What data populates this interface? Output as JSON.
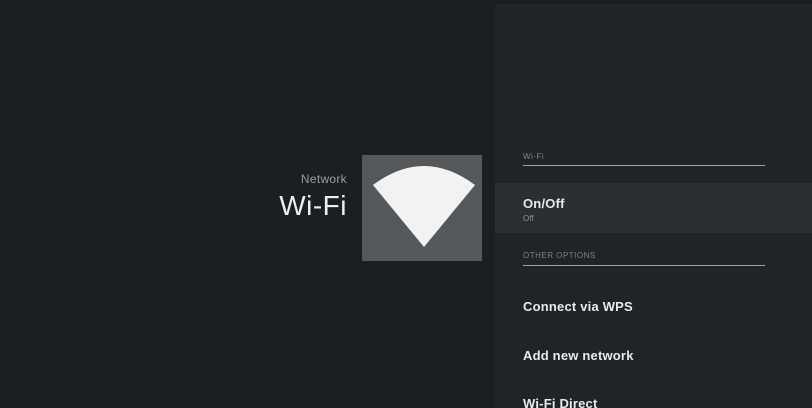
{
  "header": {
    "breadcrumb": "Network",
    "title": "Wi-Fi"
  },
  "icon": {
    "name": "wifi-icon",
    "tile_color": "#55585b",
    "glyph_color": "#f2f2f2"
  },
  "panel": {
    "section_wifi": "Wi-Fi",
    "on_off": {
      "label": "On/Off",
      "value": "Off"
    },
    "section_other": "OTHER OPTIONS",
    "options": [
      {
        "label": "Connect via WPS"
      },
      {
        "label": "Add new network"
      },
      {
        "label": "Wi-Fi Direct"
      }
    ]
  }
}
